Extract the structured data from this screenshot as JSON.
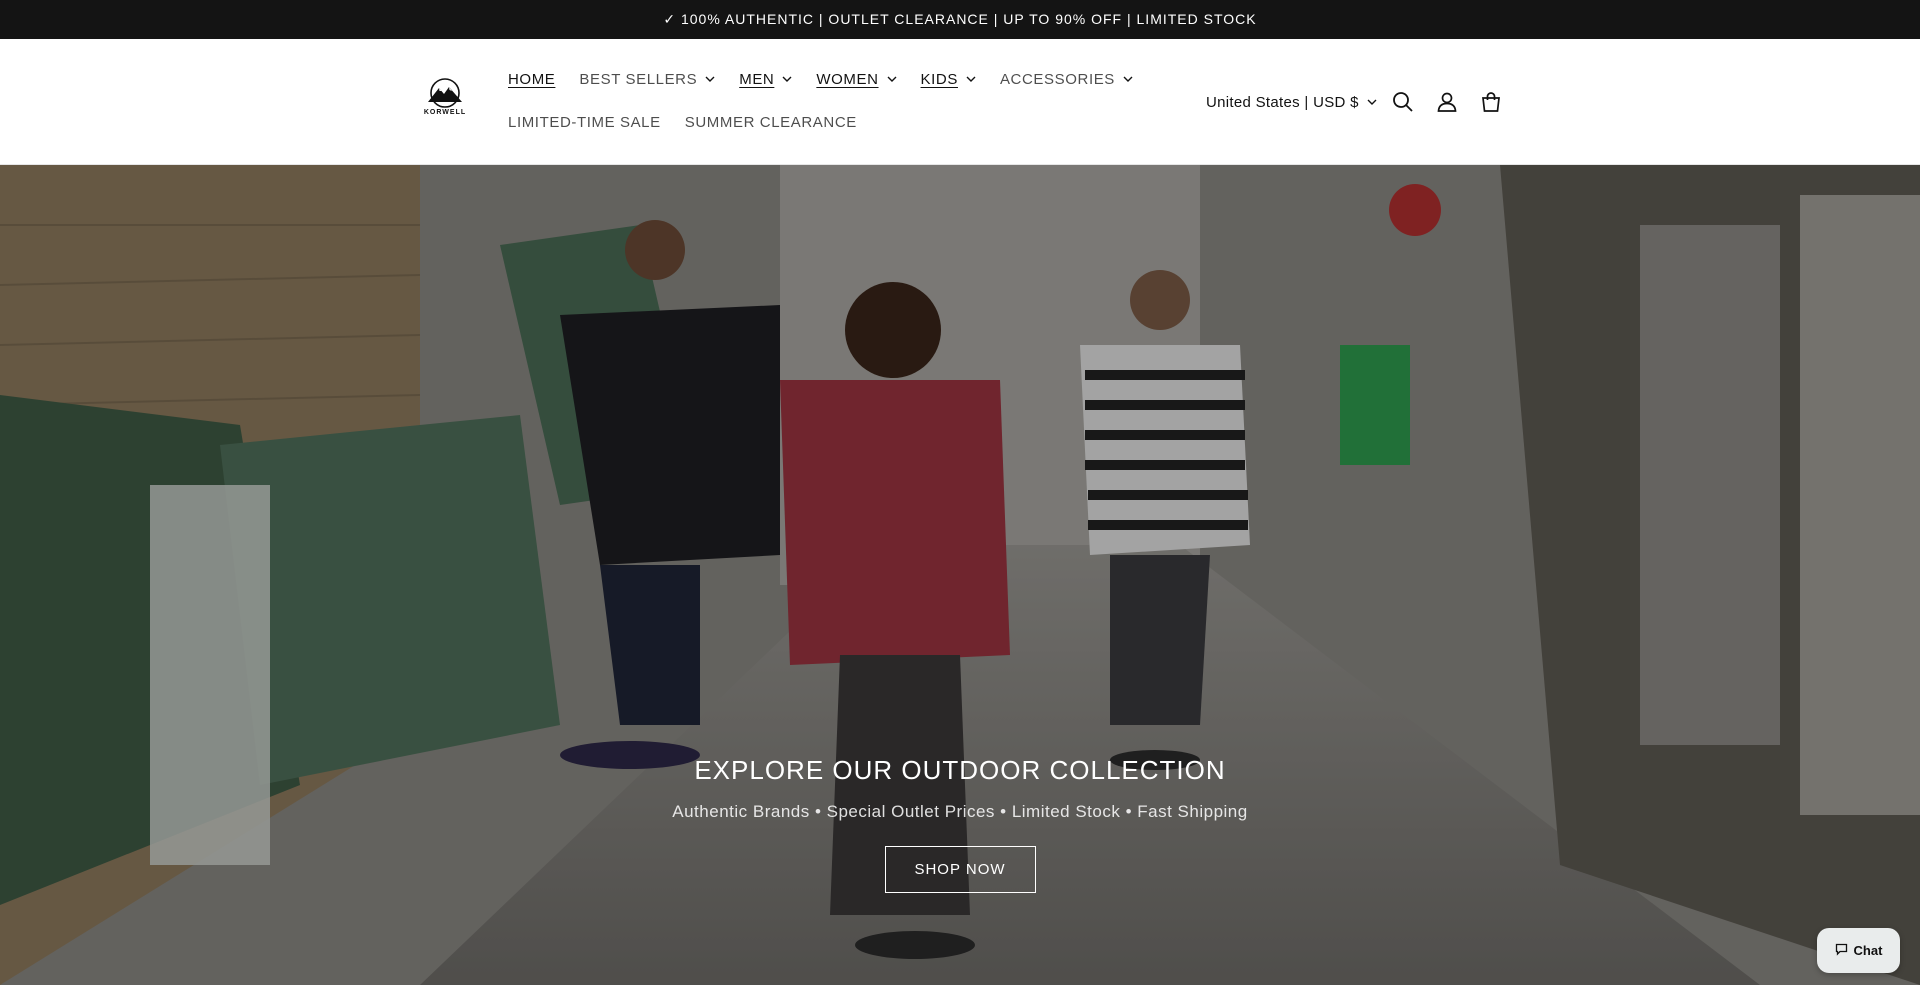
{
  "announcement": {
    "text": "✓ 100% AUTHENTIC | OUTLET CLEARANCE | UP TO 90% OFF | LIMITED STOCK"
  },
  "header": {
    "logo_text": "KORWELL",
    "nav_row1": [
      {
        "label": "HOME",
        "dropdown": false,
        "underlined": true
      },
      {
        "label": "BEST SELLERS",
        "dropdown": true,
        "underlined": false
      },
      {
        "label": "MEN",
        "dropdown": true,
        "underlined": true
      },
      {
        "label": "WOMEN",
        "dropdown": true,
        "underlined": true
      },
      {
        "label": "KIDS",
        "dropdown": true,
        "underlined": true
      },
      {
        "label": "ACCESSORIES",
        "dropdown": true,
        "underlined": false
      }
    ],
    "nav_row2": [
      {
        "label": "LIMITED-TIME SALE"
      },
      {
        "label": "SUMMER CLEARANCE"
      }
    ],
    "locale": "United States | USD $",
    "icons": [
      "search-icon",
      "account-icon",
      "cart-icon"
    ]
  },
  "hero": {
    "title": "EXPLORE OUR OUTDOOR COLLECTION",
    "subtitle": "Authentic Brands • Special Outlet Prices • Limited Stock • Fast Shipping",
    "cta": "SHOP NOW"
  },
  "chat": {
    "label": "Chat"
  },
  "colors": {
    "announcement_bg": "#141414",
    "text": "#121212",
    "white": "#ffffff"
  }
}
